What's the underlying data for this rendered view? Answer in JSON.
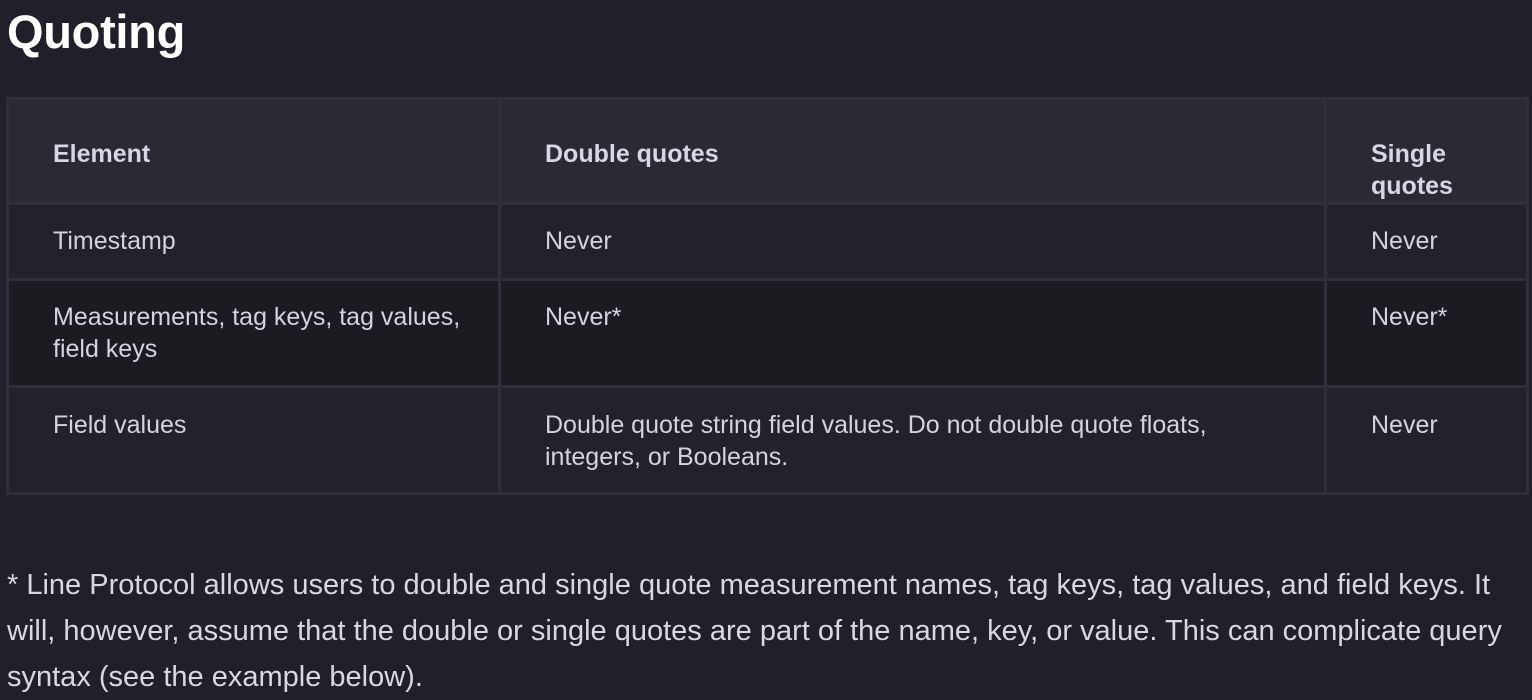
{
  "page": {
    "title": "Quoting"
  },
  "table": {
    "headers": [
      "Element",
      "Double quotes",
      "Single quotes"
    ],
    "rows": [
      [
        "Timestamp",
        "Never",
        "Never"
      ],
      [
        "Measurements, tag keys, tag values, field keys",
        "Never*",
        "Never*"
      ],
      [
        "Field values",
        "Double quote string field values. Do not double quote floats, integers, or Booleans.",
        "Never"
      ]
    ]
  },
  "footnote": "* Line Protocol allows users to double and single quote measurement names, tag keys, tag values, and field keys. It will, however, assume that the double or single quotes are part of the name, key, or value. This can complicate query syntax (see the example below)."
}
